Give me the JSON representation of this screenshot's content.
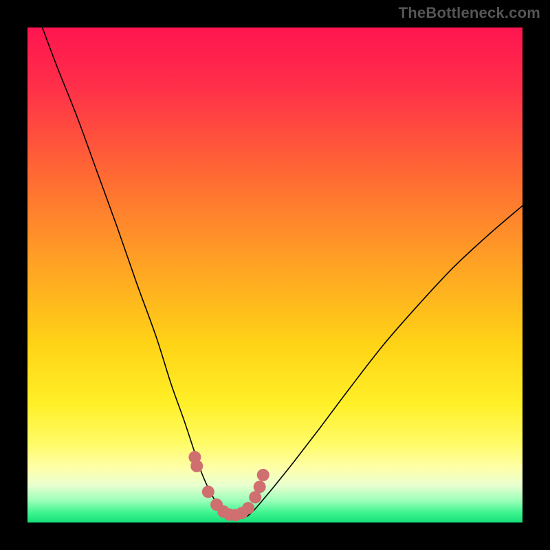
{
  "watermark": "TheBottleneck.com",
  "chart_data": {
    "type": "line",
    "title": "",
    "xlabel": "",
    "ylabel": "",
    "xlim": [
      0,
      100
    ],
    "ylim": [
      0,
      100
    ],
    "grid": false,
    "legend": false,
    "plot_background": {
      "type": "vertical-gradient",
      "stops": [
        {
          "offset": 0.0,
          "color": "#ff1550"
        },
        {
          "offset": 0.12,
          "color": "#ff2f49"
        },
        {
          "offset": 0.3,
          "color": "#ff6a33"
        },
        {
          "offset": 0.48,
          "color": "#ffa324"
        },
        {
          "offset": 0.64,
          "color": "#ffd316"
        },
        {
          "offset": 0.76,
          "color": "#fff028"
        },
        {
          "offset": 0.84,
          "color": "#fffb66"
        },
        {
          "offset": 0.89,
          "color": "#ffffaa"
        },
        {
          "offset": 0.925,
          "color": "#e8ffcf"
        },
        {
          "offset": 0.955,
          "color": "#9dffba"
        },
        {
          "offset": 0.98,
          "color": "#3ef58f"
        },
        {
          "offset": 1.0,
          "color": "#16e07a"
        }
      ]
    },
    "series": [
      {
        "name": "left-curve",
        "color": "#000000",
        "stroke_width": 1.6,
        "x": [
          3,
          6,
          10,
          14,
          18,
          22,
          26,
          29,
          31.5,
          33.5,
          35,
          36.5,
          38,
          39,
          39.7
        ],
        "y": [
          100,
          92,
          82,
          71,
          60,
          48.5,
          37.5,
          28,
          21,
          15,
          10.5,
          7,
          4.2,
          2.3,
          1.2
        ]
      },
      {
        "name": "right-curve",
        "color": "#000000",
        "stroke_width": 1.6,
        "x": [
          44.3,
          45.5,
          47.5,
          50,
          54,
          59,
          65,
          72,
          79,
          86,
          93,
          100
        ],
        "y": [
          1.2,
          2.2,
          4.5,
          7.5,
          12.5,
          19,
          27,
          36,
          44,
          51.5,
          58,
          64
        ]
      },
      {
        "name": "dots",
        "type": "scatter",
        "marker_color": "#cf6f6f",
        "marker_radius": 9,
        "x": [
          33.8,
          34.2,
          36.5,
          38.2,
          39.6,
          40.8,
          42.0,
          43.3,
          44.6,
          46.0,
          46.9,
          47.6
        ],
        "y": [
          13.2,
          11.4,
          6.2,
          3.6,
          2.2,
          1.6,
          1.5,
          1.9,
          2.9,
          5.1,
          7.2,
          9.6
        ]
      }
    ],
    "annotations": []
  }
}
